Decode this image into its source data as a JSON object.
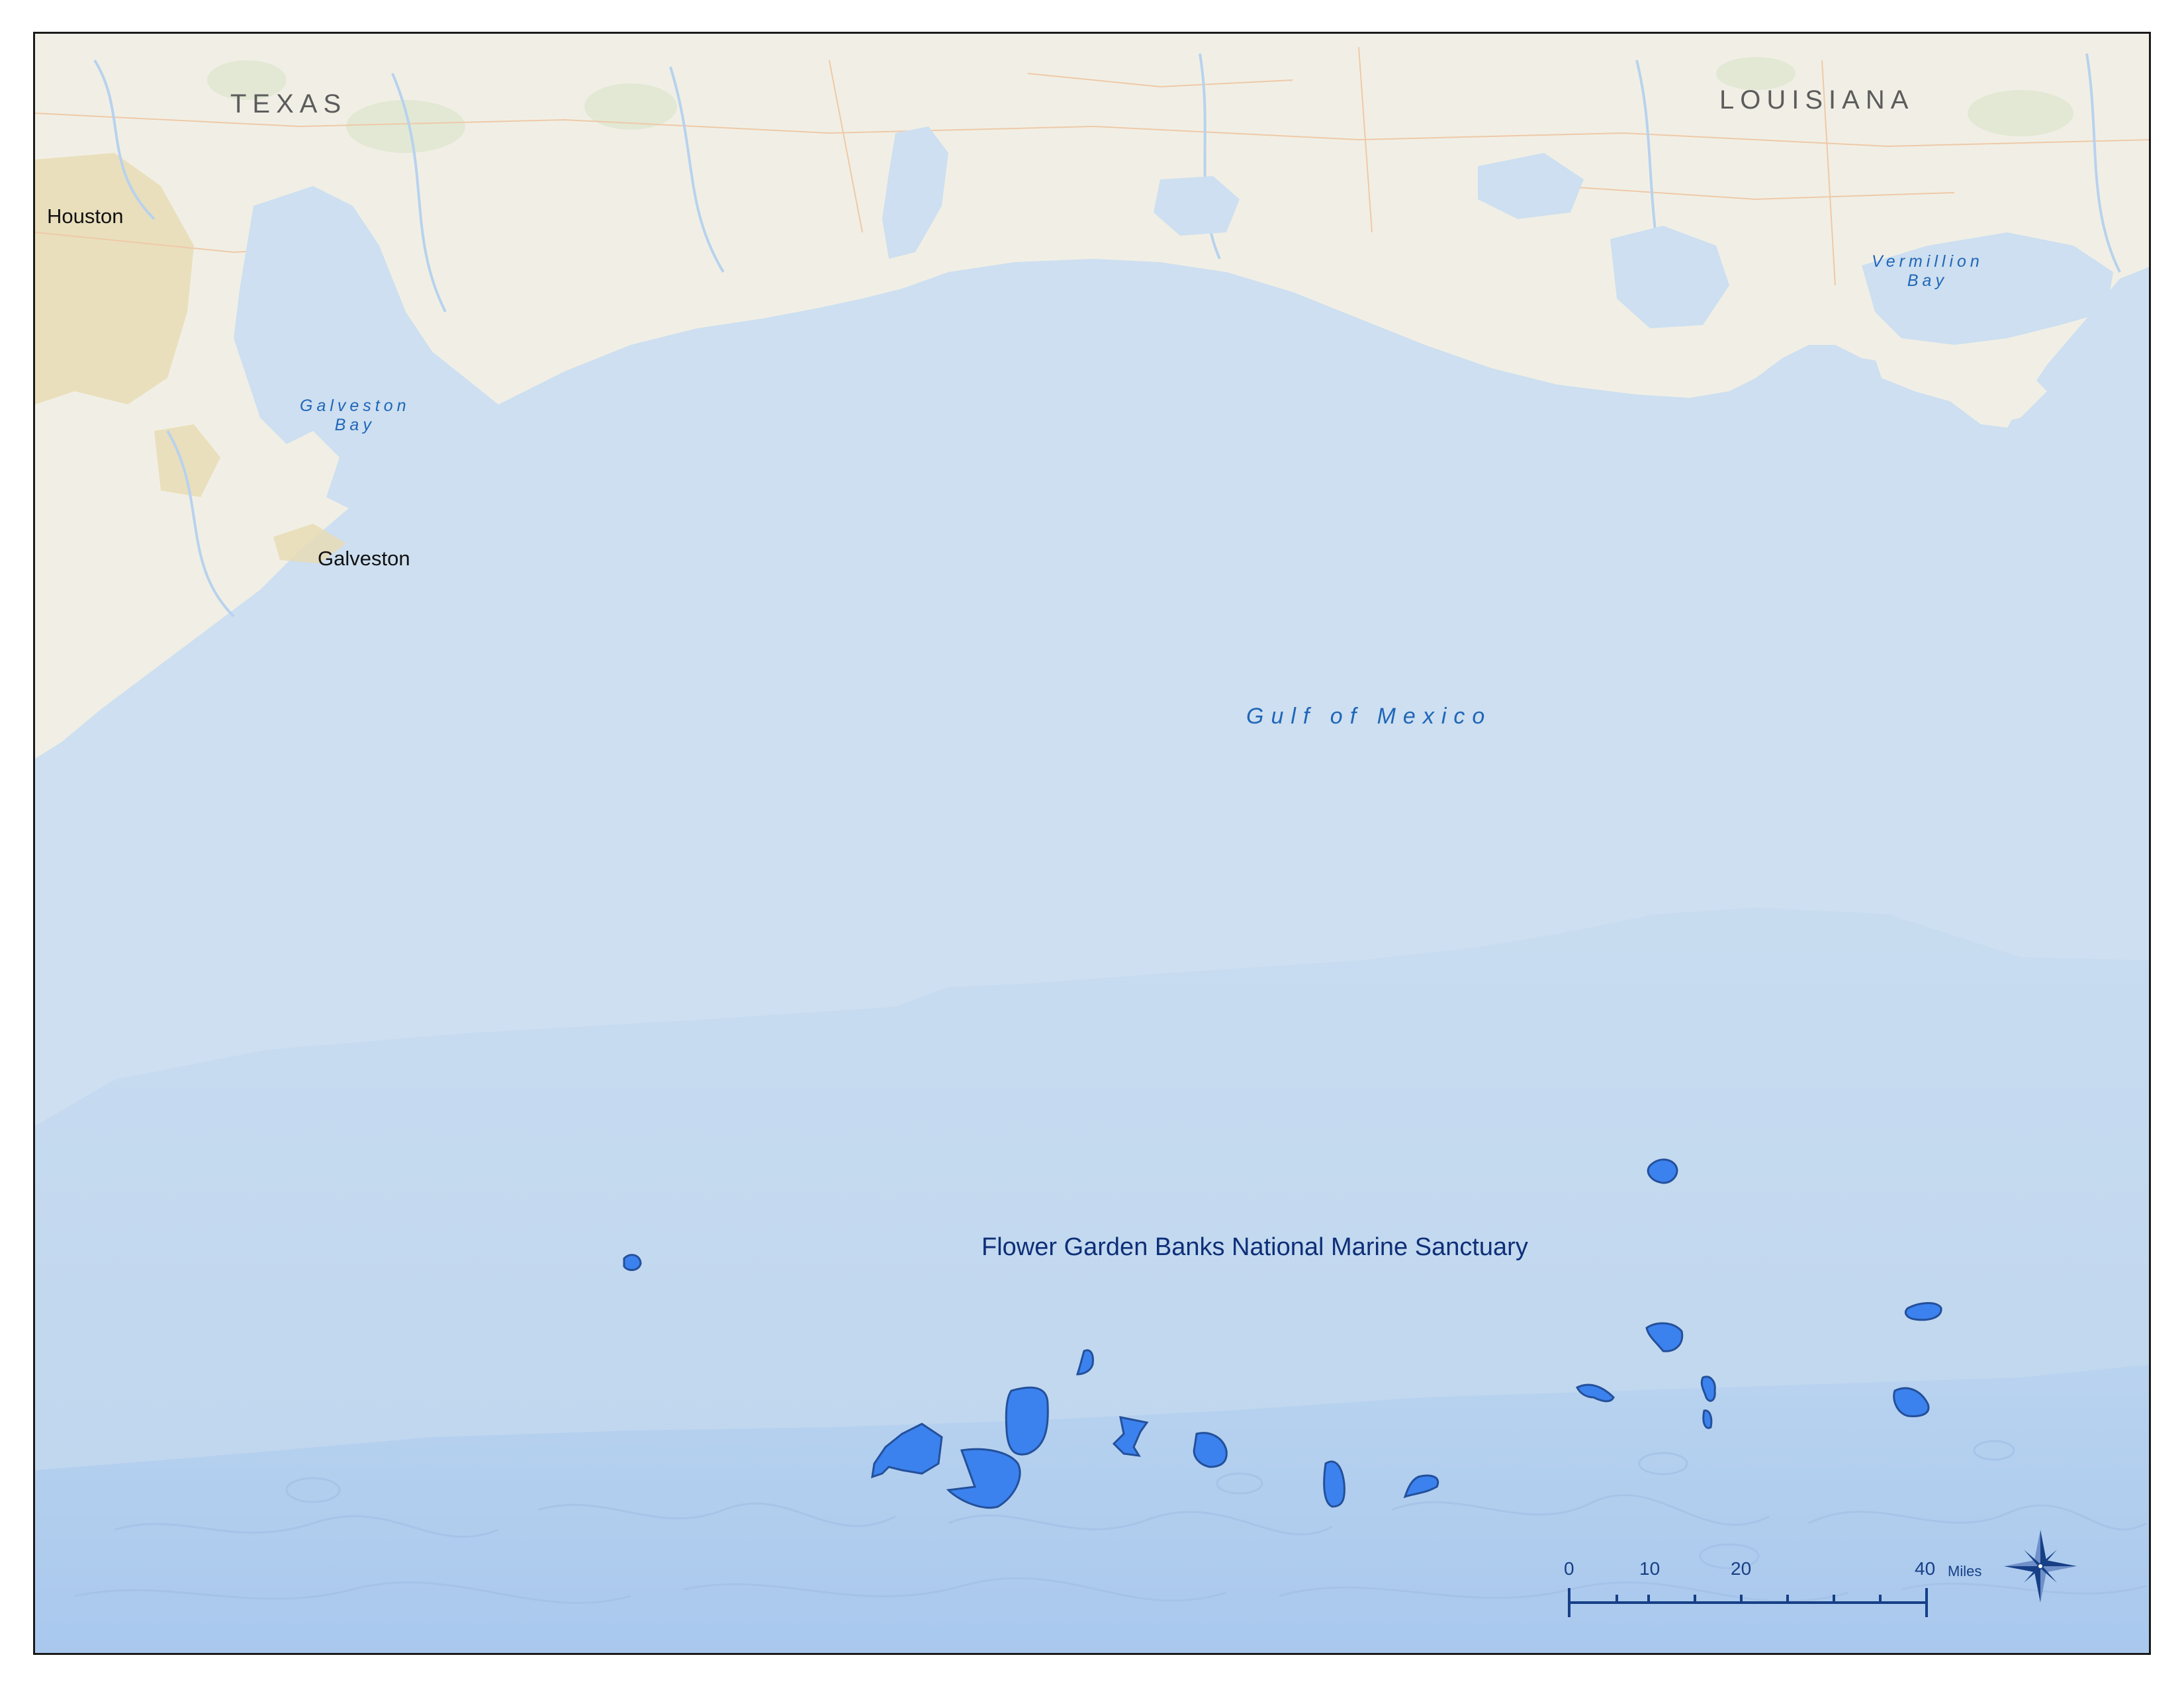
{
  "map": {
    "states": [
      "TEXAS",
      "LOUISIANA"
    ],
    "cities": [
      "Houston",
      "Galveston"
    ],
    "water_bodies": {
      "galveston_bay": [
        "Galveston",
        "Bay"
      ],
      "vermillion_bay": [
        "Vermillion",
        "Bay"
      ],
      "gulf": "Gulf of Mexico"
    },
    "sanctuary_label": "Flower Garden Banks National Marine Sanctuary",
    "colors": {
      "land": "#f1efe5",
      "water": "#cddff0",
      "deep_water": "#bcd5ee",
      "sanctuary_fill": "#3b82ee",
      "sanctuary_stroke": "#24509a",
      "scale_bar": "#163f86"
    },
    "scale_bar": {
      "ticks": [
        "0",
        "10",
        "20",
        "40"
      ],
      "unit": "Miles"
    },
    "north_arrow_icon": "compass-rose-icon"
  }
}
